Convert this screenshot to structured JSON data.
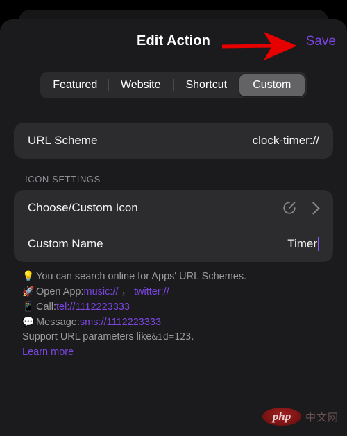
{
  "header": {
    "title": "Edit Action",
    "save_label": "Save"
  },
  "annotation": {
    "arrow_color": "#e60000",
    "points_to": "Save"
  },
  "segmented_control": {
    "options": [
      {
        "label": "Featured",
        "selected": false
      },
      {
        "label": "Website",
        "selected": false
      },
      {
        "label": "Shortcut",
        "selected": false
      },
      {
        "label": "Custom",
        "selected": true
      }
    ],
    "selected": "Custom"
  },
  "url_scheme_row": {
    "label": "URL Scheme",
    "value": "clock-timer://",
    "placeholder": "URL Scheme"
  },
  "icon_settings": {
    "section_title": "ICON SETTINGS",
    "choose_icon": {
      "label": "Choose/Custom Icon",
      "icon": "timer-icon",
      "chevron": "chevron-right-icon"
    },
    "custom_name": {
      "label": "Custom Name",
      "value": "Timer",
      "placeholder": "Custom Name"
    }
  },
  "help": {
    "line_tip": {
      "emoji": "💡",
      "text": "You can search online for Apps' URL Schemes."
    },
    "line_open_app": {
      "emoji": "🚀",
      "prefix": "Open App: ",
      "link1": "music://",
      "comma": "，",
      "link2": "twitter://"
    },
    "line_call": {
      "emoji": "📱",
      "prefix": "Call: ",
      "link": "tel://1112223333"
    },
    "line_message": {
      "emoji": "💬",
      "prefix": "Message: ",
      "link": "sms://1112223333"
    },
    "line_params_prefix": "Support URL parameters like ",
    "line_params_code": "&id=123",
    "line_params_suffix": ".",
    "learn_more": "Learn more"
  },
  "watermark": {
    "logo_text": "php",
    "site_text": "中文网"
  },
  "colors": {
    "accent_purple": "#7b45e0",
    "arrow_red": "#e60000",
    "page_bg": "#1b1b1d",
    "card_bg": "#2c2c2e",
    "segment_active": "#636366"
  }
}
